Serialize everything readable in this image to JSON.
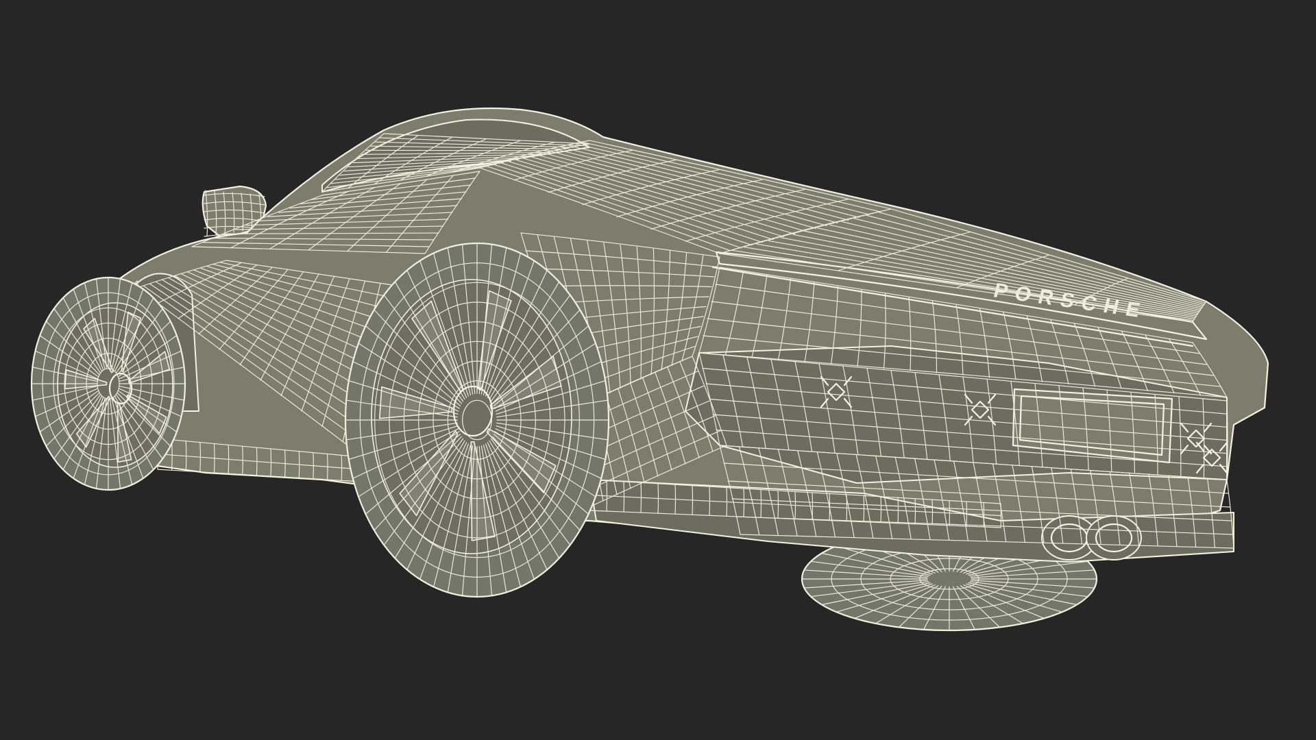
{
  "scene": {
    "subject": "car-wireframe-render",
    "background_color": "#262626",
    "mesh_fill_color": "#7c7d6c",
    "wire_color": "#eeeedd"
  },
  "rear_badge": {
    "text": "PORSCHE"
  }
}
